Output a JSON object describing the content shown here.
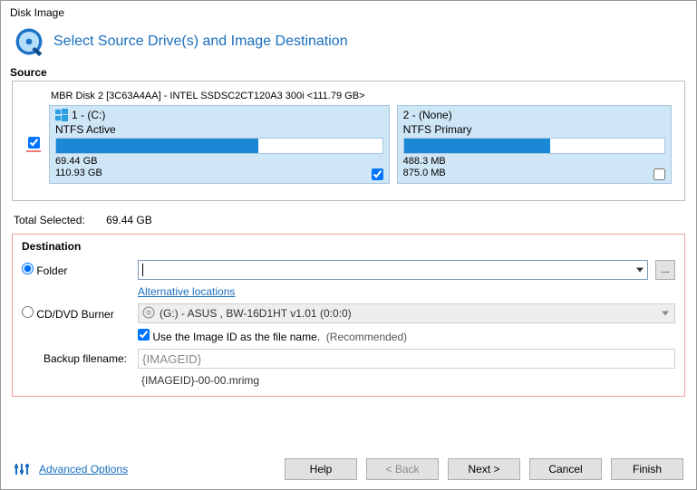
{
  "window_title": "Disk Image",
  "page_title": "Select Source Drive(s) and Image Destination",
  "source_label": "Source",
  "disk_header": "MBR Disk 2 [3C63A4AA] - INTEL SSDSC2CT120A3 300i  <111.79 GB>",
  "partitions": [
    {
      "name": "1 -  (C:)",
      "type": "NTFS Active",
      "used": "69.44 GB",
      "total": "110.93 GB",
      "fill_pct": 62,
      "checked": true,
      "has_os_icon": true
    },
    {
      "name": "2 -  (None)",
      "type": "NTFS Primary",
      "used": "488.3 MB",
      "total": "875.0 MB",
      "fill_pct": 56,
      "checked": false,
      "has_os_icon": false
    }
  ],
  "total_selected_label": "Total Selected:",
  "total_selected_value": "69.44 GB",
  "destination": {
    "section_label": "Destination",
    "folder_label": "Folder",
    "folder_value": "",
    "browse_label": "...",
    "alt_locations": "Alternative locations",
    "burner_label": "CD/DVD Burner",
    "burner_value": "(G:) - ASUS    , BW-16D1HT      v1.01 (0:0:0)",
    "use_imageid_label": "Use the Image ID as the file name.",
    "recommended": "(Recommended)",
    "filename_label": "Backup filename:",
    "filename_value": "{IMAGEID}",
    "example_filename": "{IMAGEID}-00-00.mrimg"
  },
  "footer": {
    "advanced": "Advanced Options",
    "help": "Help",
    "back": "< Back",
    "next": "Next >",
    "cancel": "Cancel",
    "finish": "Finish"
  }
}
